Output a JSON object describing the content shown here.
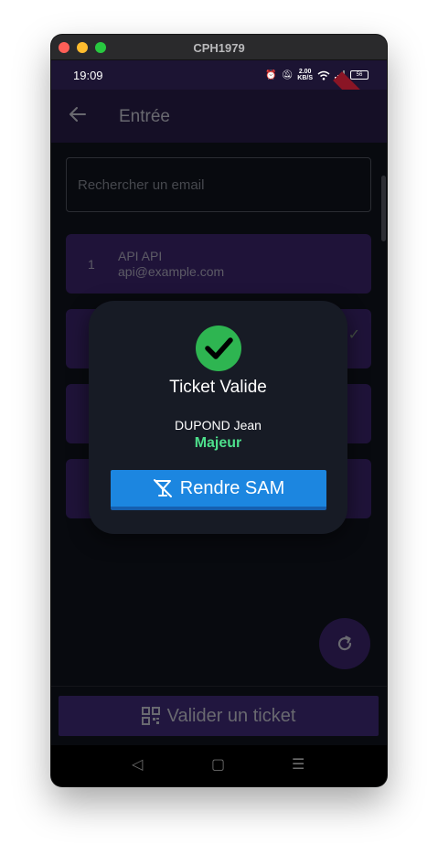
{
  "window": {
    "title": "CPH1979"
  },
  "status_bar": {
    "time": "19:09",
    "net_speed_value": "2.00",
    "net_speed_unit": "KB/S",
    "battery": "56"
  },
  "debug_ribbon": "DEBUG",
  "app_bar": {
    "title": "Entrée",
    "back_icon": "arrow-left-icon"
  },
  "search": {
    "placeholder": "Rechercher un email",
    "value": ""
  },
  "list": {
    "items": [
      {
        "index": "1",
        "name": "API API",
        "email": "api@example.com"
      }
    ]
  },
  "fab": {
    "icon": "refresh-icon"
  },
  "validate_button": {
    "label": "Valider un ticket",
    "icon": "qr-code-icon"
  },
  "nav": {
    "back": "◁",
    "home": "▢",
    "menu": "☰"
  },
  "dialog": {
    "icon": "check-circle-icon",
    "title": "Ticket Valide",
    "person": "DUPOND Jean",
    "status": "Majeur",
    "button_label": "Rendre SAM",
    "button_icon": "no-drink-icon"
  },
  "colors": {
    "background": "#0b0e14",
    "primary": "#1c1433",
    "card": "#2a1a4d",
    "dialog_bg": "#171b25",
    "success": "#2eb551",
    "majeur": "#4ddf8b",
    "button_blue": "#1c86e0"
  }
}
